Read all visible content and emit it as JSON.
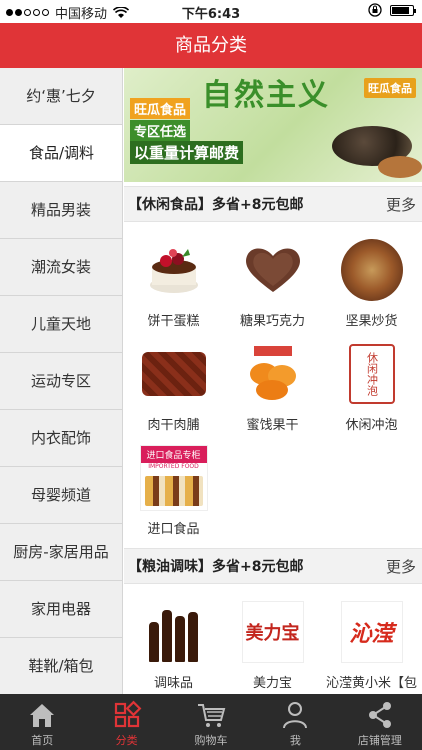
{
  "status_bar": {
    "carrier": "中国移动",
    "time": "下午6:43"
  },
  "nav": {
    "title": "商品分类"
  },
  "sidebar": {
    "items": [
      {
        "label": "约‘惠’七夕"
      },
      {
        "label": "食品/调料",
        "active": true
      },
      {
        "label": "精品男装"
      },
      {
        "label": "潮流女装"
      },
      {
        "label": "儿童天地"
      },
      {
        "label": "运动专区"
      },
      {
        "label": "内衣配饰"
      },
      {
        "label": "母婴频道"
      },
      {
        "label": "厨房-家居用品"
      },
      {
        "label": "家用电器"
      },
      {
        "label": "鞋靴/箱包"
      }
    ]
  },
  "banner": {
    "title": "自然主义",
    "brand": "旺瓜食品",
    "line1": "旺瓜食品",
    "line2": "专区任选",
    "line3": "以重量计算邮费"
  },
  "sections": [
    {
      "title": "【休闲食品】多省+8元包邮",
      "more": "更多",
      "items": [
        {
          "label": "饼干蛋糕",
          "icon": "cake-icon"
        },
        {
          "label": "糖果巧克力",
          "icon": "chocolate-icon"
        },
        {
          "label": "坚果炒货",
          "icon": "nuts-icon"
        },
        {
          "label": "肉干肉脯",
          "icon": "jerky-icon"
        },
        {
          "label": "蜜饯果干",
          "icon": "dried-fruit-icon"
        },
        {
          "label": "休闲冲泡",
          "icon": "tea-icon"
        },
        {
          "label": "进口食品",
          "icon": "imported-food-icon"
        }
      ]
    },
    {
      "title": "【粮油调味】多省+8元包邮",
      "more": "更多",
      "items": [
        {
          "label": "调味品",
          "icon": "sauce-icon"
        },
        {
          "label": "美力宝",
          "icon": "meilibao-logo",
          "logo_text": "美力宝"
        },
        {
          "label": "沁滢黄小米【包",
          "icon": "qinying-logo",
          "logo_text": "沁滢"
        }
      ]
    }
  ],
  "import_badge": {
    "line1": "进口食品专柜",
    "line2": "IMPORTED FOOD"
  },
  "tea_stamp": "休闲冲泡",
  "tabs": [
    {
      "label": "首页",
      "icon": "home-icon"
    },
    {
      "label": "分类",
      "icon": "category-icon",
      "active": true
    },
    {
      "label": "购物车",
      "icon": "cart-icon"
    },
    {
      "label": "我",
      "icon": "user-icon"
    },
    {
      "label": "店铺管理",
      "icon": "share-icon"
    }
  ],
  "colors": {
    "accent": "#e03437",
    "tabbar": "#2b2b2b",
    "sidebar_bg": "#efefef"
  }
}
